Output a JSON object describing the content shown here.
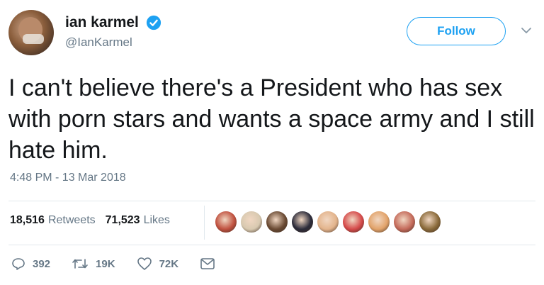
{
  "user": {
    "display_name": "ian karmel",
    "handle": "@IanKarmel",
    "verified_icon": "verified-badge-icon"
  },
  "follow_label": "Follow",
  "tweet": {
    "text": "I can't believe there's a President who has sex with porn stars and wants a space army and I still hate him.",
    "timestamp": "4:48 PM - 13 Mar 2018"
  },
  "stats": {
    "retweets_count": "18,516",
    "retweets_label": "Retweets",
    "likes_count": "71,523",
    "likes_label": "Likes"
  },
  "likers": [
    "#c0513f",
    "#d8c9b0",
    "#6a4a33",
    "#2b2b3a",
    "#e3b48c",
    "#d54a4a",
    "#e2a36a",
    "#c46a5a",
    "#8a6a3a"
  ],
  "actions": {
    "reply_count": "392",
    "retweet_count": "19K",
    "like_count": "72K"
  },
  "colors": {
    "accent": "#1da1f2",
    "muted": "#657786",
    "text": "#14171a"
  }
}
